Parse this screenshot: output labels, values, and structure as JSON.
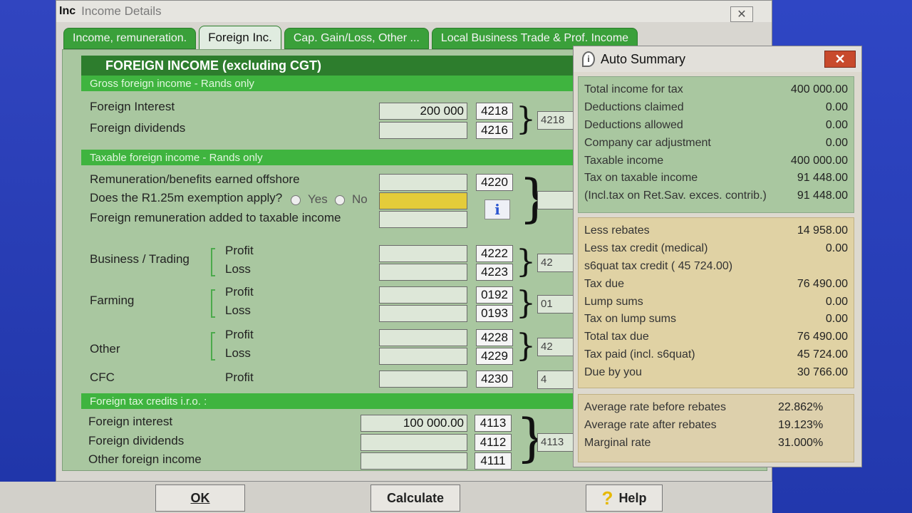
{
  "window": {
    "app_badge": "Inc",
    "title": "Income Details",
    "close_label": "✕"
  },
  "tabs": [
    {
      "label": "Income, remuneration."
    },
    {
      "label": "Foreign Inc."
    },
    {
      "label": "Cap. Gain/Loss, Other ..."
    },
    {
      "label": "Local Business Trade & Prof. Income"
    }
  ],
  "form": {
    "header": "FOREIGN INCOME (excluding CGT)",
    "gross_section": "Gross foreign income - Rands only",
    "foreign_interest_label": "Foreign Interest",
    "foreign_interest_value": "200 000",
    "foreign_interest_code": "4218",
    "foreign_dividends_label": "Foreign dividends",
    "foreign_dividends_value": "",
    "foreign_dividends_code": "4216",
    "gross_total_code": "4218",
    "taxable_section": "Taxable foreign income - Rands only",
    "remuneration_label": "Remuneration/benefits earned offshore",
    "remuneration_code": "4220",
    "exemption_question": "Does the R1.25m exemption apply?",
    "yes_label": "Yes",
    "no_label": "No",
    "foreign_rem_added_label": "Foreign remuneration added to taxable income",
    "info_icon_glyph": "i",
    "business_label": "Business / Trading",
    "business_profit_code": "4222",
    "business_loss_code": "4223",
    "business_total": "42",
    "farming_label": "Farming",
    "farming_profit_code": "0192",
    "farming_loss_code": "0193",
    "farming_total": "01",
    "other_label": "Other",
    "other_profit_code": "4228",
    "other_loss_code": "4229",
    "other_total": "42",
    "cfc_label": "CFC",
    "cfc_profit_code": "4230",
    "cfc_total": "4",
    "profit_label": "Profit",
    "loss_label": "Loss",
    "credits_section": "Foreign tax credits i.r.o. :",
    "credit_interest_label": "Foreign interest",
    "credit_interest_value": "100 000.00",
    "credit_interest_code": "4113",
    "credit_dividends_label": "Foreign dividends",
    "credit_dividends_code": "4112",
    "credit_other_label": "Other foreign income",
    "credit_other_code": "4111",
    "credit_total_code": "4113"
  },
  "buttons": {
    "ok": "OK",
    "calculate": "Calculate",
    "help": "Help",
    "help_glyph": "?"
  },
  "summary": {
    "title": "Auto Summary",
    "close_label": "✕",
    "section1": [
      {
        "label": "Total income for tax",
        "value": "400 000.00"
      },
      {
        "label": "Deductions claimed",
        "value": "0.00"
      },
      {
        "label": "Deductions allowed",
        "value": "0.00"
      },
      {
        "label": "Company car adjustment",
        "value": "0.00"
      },
      {
        "label": "Taxable income",
        "value": "400 000.00"
      },
      {
        "label": "Tax on taxable income",
        "value": "91 448.00"
      },
      {
        "label": "(Incl.tax on Ret.Sav. exces. contrib.)",
        "value": "91 448.00"
      }
    ],
    "section2": [
      {
        "label": "Less rebates",
        "value": "14 958.00"
      },
      {
        "label": "Less tax credit (medical)",
        "value": "0.00"
      },
      {
        "label": "s6quat tax credit (  45 724.00)",
        "value": ""
      },
      {
        "label": "Tax due",
        "value": "76 490.00"
      },
      {
        "label": "Lump sums",
        "value": "0.00"
      },
      {
        "label": "Tax on lump sums",
        "value": "0.00"
      },
      {
        "label": "Total tax due",
        "value": "76 490.00"
      },
      {
        "label": "Tax paid (incl. s6quat)",
        "value": "45 724.00"
      },
      {
        "label": "Due by you",
        "value": "30 766.00"
      }
    ],
    "section3": [
      {
        "label": "Average rate before rebates",
        "value": "22.862%"
      },
      {
        "label": "Average rate after rebates",
        "value": "19.123%"
      },
      {
        "label": "Marginal rate",
        "value": "31.000%"
      }
    ]
  }
}
